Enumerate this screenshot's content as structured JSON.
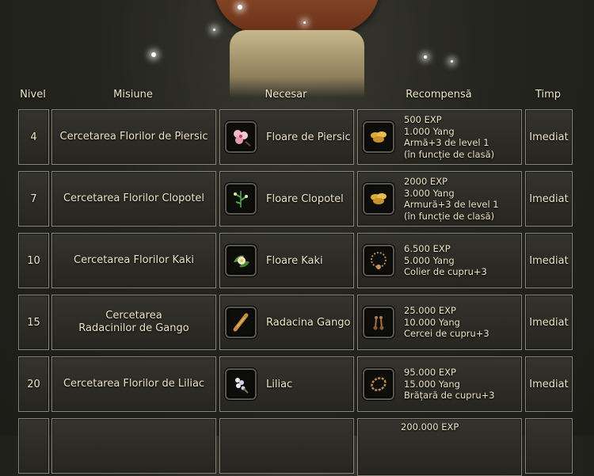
{
  "headers": {
    "level": "Nivel",
    "quest": "Misiune",
    "required": "Necesar",
    "reward": "Recompensă",
    "time": "Timp"
  },
  "rows": [
    {
      "level": "4",
      "quest": "Cercetarea Florilor de Piersic",
      "required_item": "Floare de Piersic",
      "required_icon": "peach-blossom-icon",
      "reward_icon": "gold-coins-icon",
      "reward_lines": [
        "500 EXP",
        "1.000  Yang",
        "Armă+3 de level 1",
        "(în funcție de clasă)"
      ],
      "time": "Imediat"
    },
    {
      "level": "7",
      "quest": "Cercetarea Florilor Clopotel",
      "required_item": "Floare Clopotel",
      "required_icon": "bellflower-icon",
      "reward_icon": "gold-coins-icon",
      "reward_lines": [
        "2000 EXP",
        "3.000  Yang",
        "Armură+3 de level 1",
        "(în funcție de clasă)"
      ],
      "time": "Imediat"
    },
    {
      "level": "10",
      "quest": "Cercetarea Florilor Kaki",
      "required_item": "Floare Kaki",
      "required_icon": "kaki-flower-icon",
      "reward_icon": "copper-necklace-icon",
      "reward_lines": [
        "6.500 EXP",
        "5.000  Yang",
        " Colier de cupru+3"
      ],
      "time": "Imediat"
    },
    {
      "level": "15",
      "quest_lines": [
        "Cercetarea",
        "Radacinilor de Gango"
      ],
      "required_item": "Radacina Gango",
      "required_icon": "gango-root-icon",
      "reward_icon": "copper-earrings-icon",
      "reward_lines": [
        "25.000 EXP",
        "10.000 Yang",
        "Cercei de cupru+3"
      ],
      "time": "Imediat"
    },
    {
      "level": "20",
      "quest": "Cercetarea Florilor de Liliac",
      "required_item": "Liliac",
      "required_icon": "lilac-icon",
      "reward_icon": "copper-bracelet-icon",
      "reward_lines": [
        "95.000 EXP",
        "15.000 Yang",
        "Brățară de cupru+3"
      ],
      "time": "Imediat"
    },
    {
      "reward_lines": [
        "200.000 EXP"
      ]
    }
  ]
}
